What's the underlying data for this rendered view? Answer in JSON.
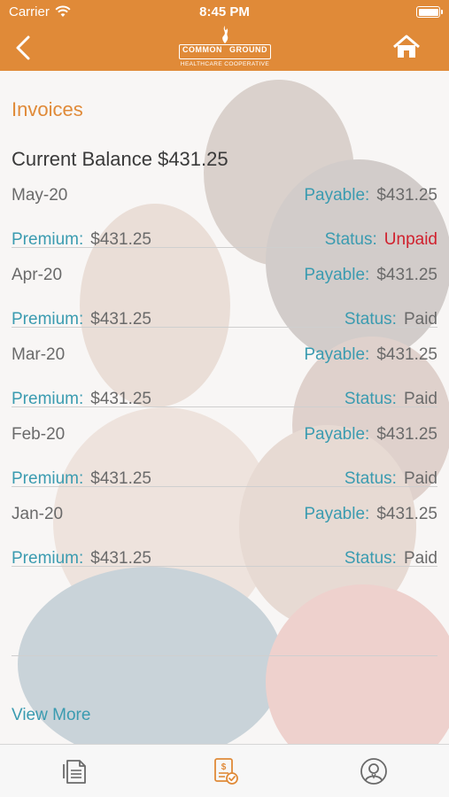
{
  "status_bar": {
    "carrier": "Carrier",
    "time": "8:45 PM"
  },
  "logo": {
    "word_left": "COMMON",
    "word_right": "GROUND",
    "subtitle": "HEALTHCARE COOPERATIVE"
  },
  "page": {
    "title": "Invoices",
    "balance": "Current Balance $431.25"
  },
  "labels": {
    "payable": "Payable:",
    "premium": "Premium:",
    "status": "Status:"
  },
  "invoices": [
    {
      "month": "May-20",
      "payable": "$431.25",
      "premium": "$431.25",
      "status": "Unpaid"
    },
    {
      "month": "Apr-20",
      "payable": "$431.25",
      "premium": "$431.25",
      "status": "Paid"
    },
    {
      "month": "Mar-20",
      "payable": "$431.25",
      "premium": "$431.25",
      "status": "Paid"
    },
    {
      "month": "Feb-20",
      "payable": "$431.25",
      "premium": "$431.25",
      "status": "Paid"
    },
    {
      "month": "Jan-20",
      "payable": "$431.25",
      "premium": "$431.25",
      "status": "Paid"
    }
  ],
  "view_more": "View More",
  "icons": {
    "back": "chevron-left-icon",
    "home": "home-icon",
    "tabs": [
      "document-list-icon",
      "invoice-dollar-icon",
      "user-profile-icon"
    ]
  },
  "colors": {
    "brand": "#e08a38",
    "label": "#3a9bb0",
    "unpaid": "#d0212e",
    "text": "#6a6a6a"
  }
}
